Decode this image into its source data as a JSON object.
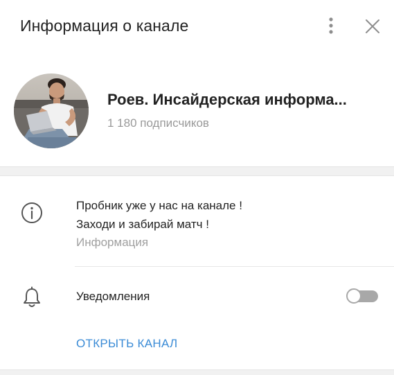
{
  "header": {
    "title": "Информация о канале",
    "more_icon": "more-vertical-icon",
    "close_icon": "close-icon"
  },
  "profile": {
    "name": "Роев. Инсайдерская информа...",
    "subscribers": "1 180 подписчиков"
  },
  "info": {
    "icon": "info-icon",
    "description_line1": "Пробник уже у нас на канале !",
    "description_line2": "Заходи и забирай матч !",
    "label": "Информация"
  },
  "notifications": {
    "icon": "bell-icon",
    "label": "Уведомления",
    "enabled": false
  },
  "actions": {
    "open_channel": "ОТКРЫТЬ КАНАЛ"
  },
  "colors": {
    "accent": "#3a8bd6",
    "text": "#222222",
    "secondary_text": "#999999",
    "separator": "#f1f1f1"
  }
}
